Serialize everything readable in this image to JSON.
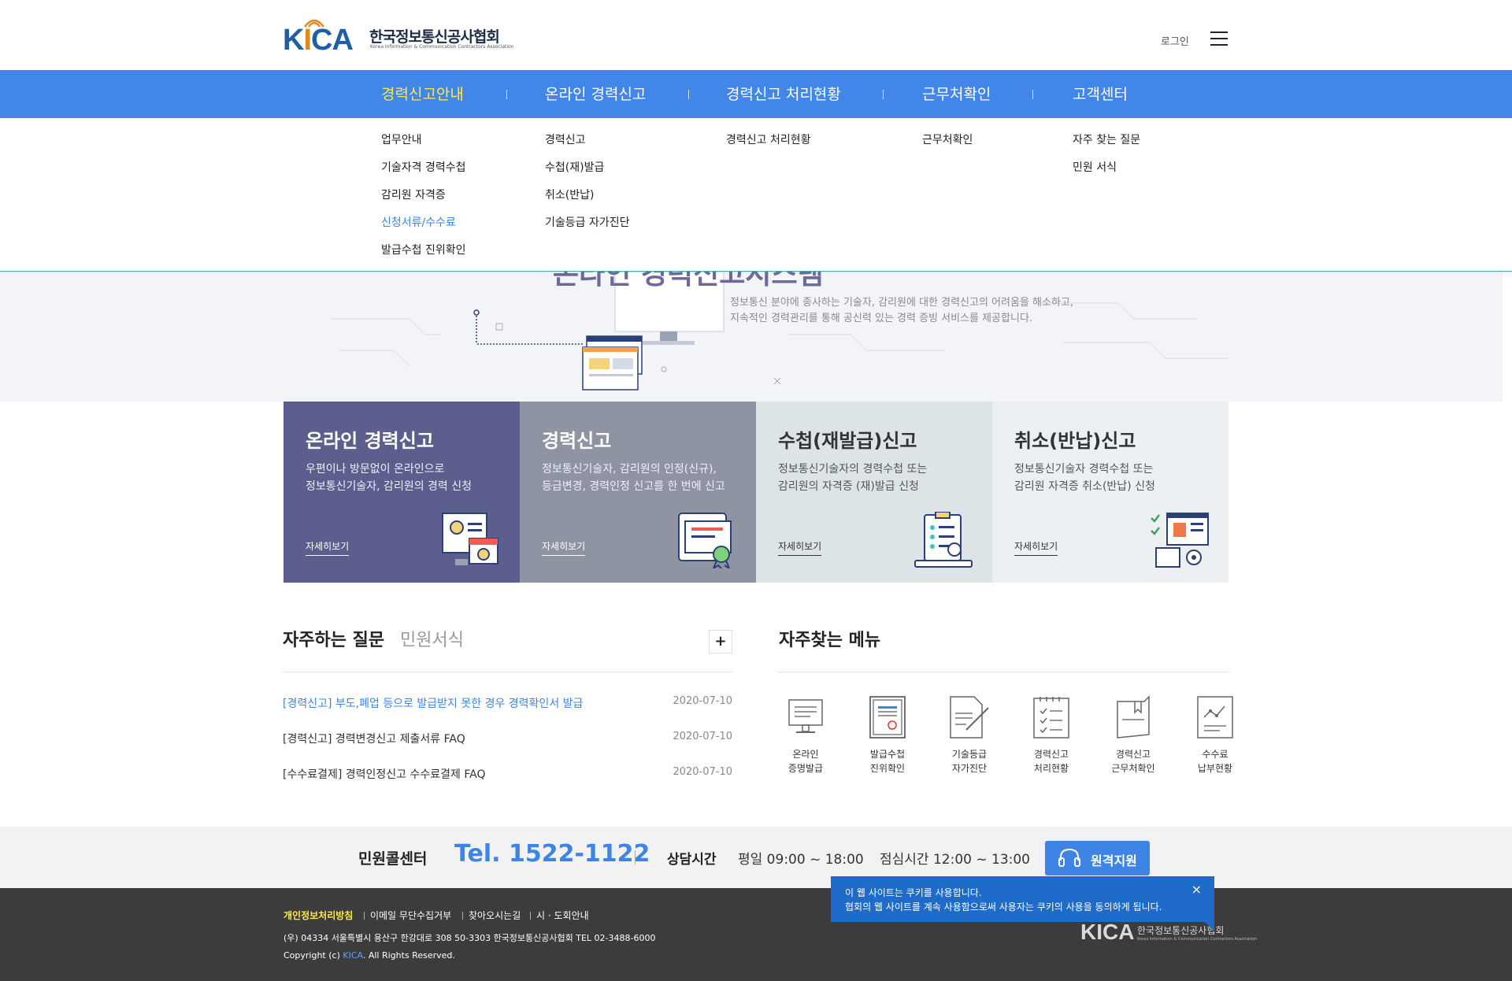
{
  "header": {
    "logo_en_k": "K",
    "logo_en_i": "I",
    "logo_en_ca": "CA",
    "logo_ko": "한국정보통신공사협회",
    "logo_sub": "Korea Information & Communication Contractors Association",
    "login": "로그인"
  },
  "gnb": [
    {
      "label": "경력신고안내",
      "sub": [
        "업무안내",
        "기술자격 경력수첩",
        "감리원 자격증",
        "신청서류/수수료",
        "발급수첩 진위확인"
      ]
    },
    {
      "label": "온라인 경력신고",
      "sub": [
        "경력신고",
        "수첩(재)발급",
        "취소(반납)",
        "기술등급 자가진단"
      ]
    },
    {
      "label": "경력신고 처리현황",
      "sub": [
        "경력신고 처리현황"
      ]
    },
    {
      "label": "근무처확인",
      "sub": [
        "근무처확인"
      ]
    },
    {
      "label": "고객센터",
      "sub": [
        "자주 찾는 질문",
        "민원 서식"
      ]
    }
  ],
  "hero": {
    "title": "온라인 경력신고시스템",
    "desc1": "정보통신 분야에 종사하는 기술자, 감리원에 대한 경력신고의 어려움을 해소하고,",
    "desc2": "지속적인 경력관리를 통해 공신력 있는 경력 증빙 서비스를 제공합니다."
  },
  "cards": [
    {
      "title": "온라인 경력신고",
      "line1": "우편이나 방문없이 온라인으로",
      "line2": "정보통신기술자, 감리원의 경력 신청",
      "more": "자세히보기"
    },
    {
      "title": "경력신고",
      "line1": "정보통신기술자, 감리원의 인정(신규),",
      "line2": "등급변경, 경력인정 신고를 한 번에 신고",
      "more": "자세히보기"
    },
    {
      "title": "수첩(재발급)신고",
      "line1": "정보통신기술자의 경력수첩 또는",
      "line2": "감리원의 자격증 (재)발급 신청",
      "more": "자세히보기"
    },
    {
      "title": "취소(반납)신고",
      "line1": "정보통신기술자 경력수첩 또는",
      "line2": "감리원 자격증 취소(반납) 신청",
      "more": "자세히보기"
    }
  ],
  "faq": {
    "tab_on": "자주하는 질문",
    "tab_off": "민원서식",
    "plus": "+",
    "rows": [
      {
        "title": "[경력신고] 부도,폐업 등으로 발급받지 못한 경우 경력확인서 발급",
        "date": "2020-07-10"
      },
      {
        "title": "[경력신고] 경력변경신고 제출서류 FAQ",
        "date": "2020-07-10"
      },
      {
        "title": "[수수료결제] 경력인정신고 수수료결제 FAQ",
        "date": "2020-07-10"
      }
    ]
  },
  "quick": {
    "title": "자주찾는 메뉴",
    "items": [
      {
        "l1": "온라인",
        "l2": "증명발급",
        "icon": "monitor-icon"
      },
      {
        "l1": "발급수첩",
        "l2": "진위확인",
        "icon": "certificate-icon"
      },
      {
        "l1": "기술등급",
        "l2": "자가진단",
        "icon": "document-pen-icon"
      },
      {
        "l1": "경력신고",
        "l2": "처리현황",
        "icon": "checklist-icon"
      },
      {
        "l1": "경력신고",
        "l2": "근무처확인",
        "icon": "bookmark-doc-icon"
      },
      {
        "l1": "수수료",
        "l2": "납부현황",
        "icon": "chart-doc-icon"
      }
    ]
  },
  "callbar": {
    "label": "민원콜센터",
    "tel": "Tel. 1522-1122",
    "hours_label": "상담시간",
    "hours": "평일 09:00 ~ 18:00",
    "lunch": "점심시간 12:00 ~ 13:00",
    "remote": "원격지원"
  },
  "footer": {
    "links": [
      "개인정보처리방침",
      "이메일 무단수집거부",
      "찾아오시는길",
      "시 · 도회안내"
    ],
    "address": "(우) 04334   서울특별시 용산구 한강대로 308 50-3303  한국정보통신공사협회  TEL 02-3488-6000",
    "copy_pre": "Copyright (c) ",
    "copy_k": "KICA",
    "copy_post": ". All Rights Reserved.",
    "logo_en": "KICA",
    "logo_ko": "한국정보통신공사협회",
    "logo_sub": "Korea Information & Communication Contractors Association"
  },
  "cookie": {
    "line1": "이 웹 사이트는 쿠키를 사용합니다.",
    "line2": "협회의 웹 사이트를 계속 사용함으로써 사용자는 쿠키의 사용을 동의하게 됩니다.",
    "close": "×"
  },
  "colors": {
    "brand_blue": "#4286ea",
    "active_yellow": "#ffe94f",
    "link_blue": "#3e84e4"
  }
}
